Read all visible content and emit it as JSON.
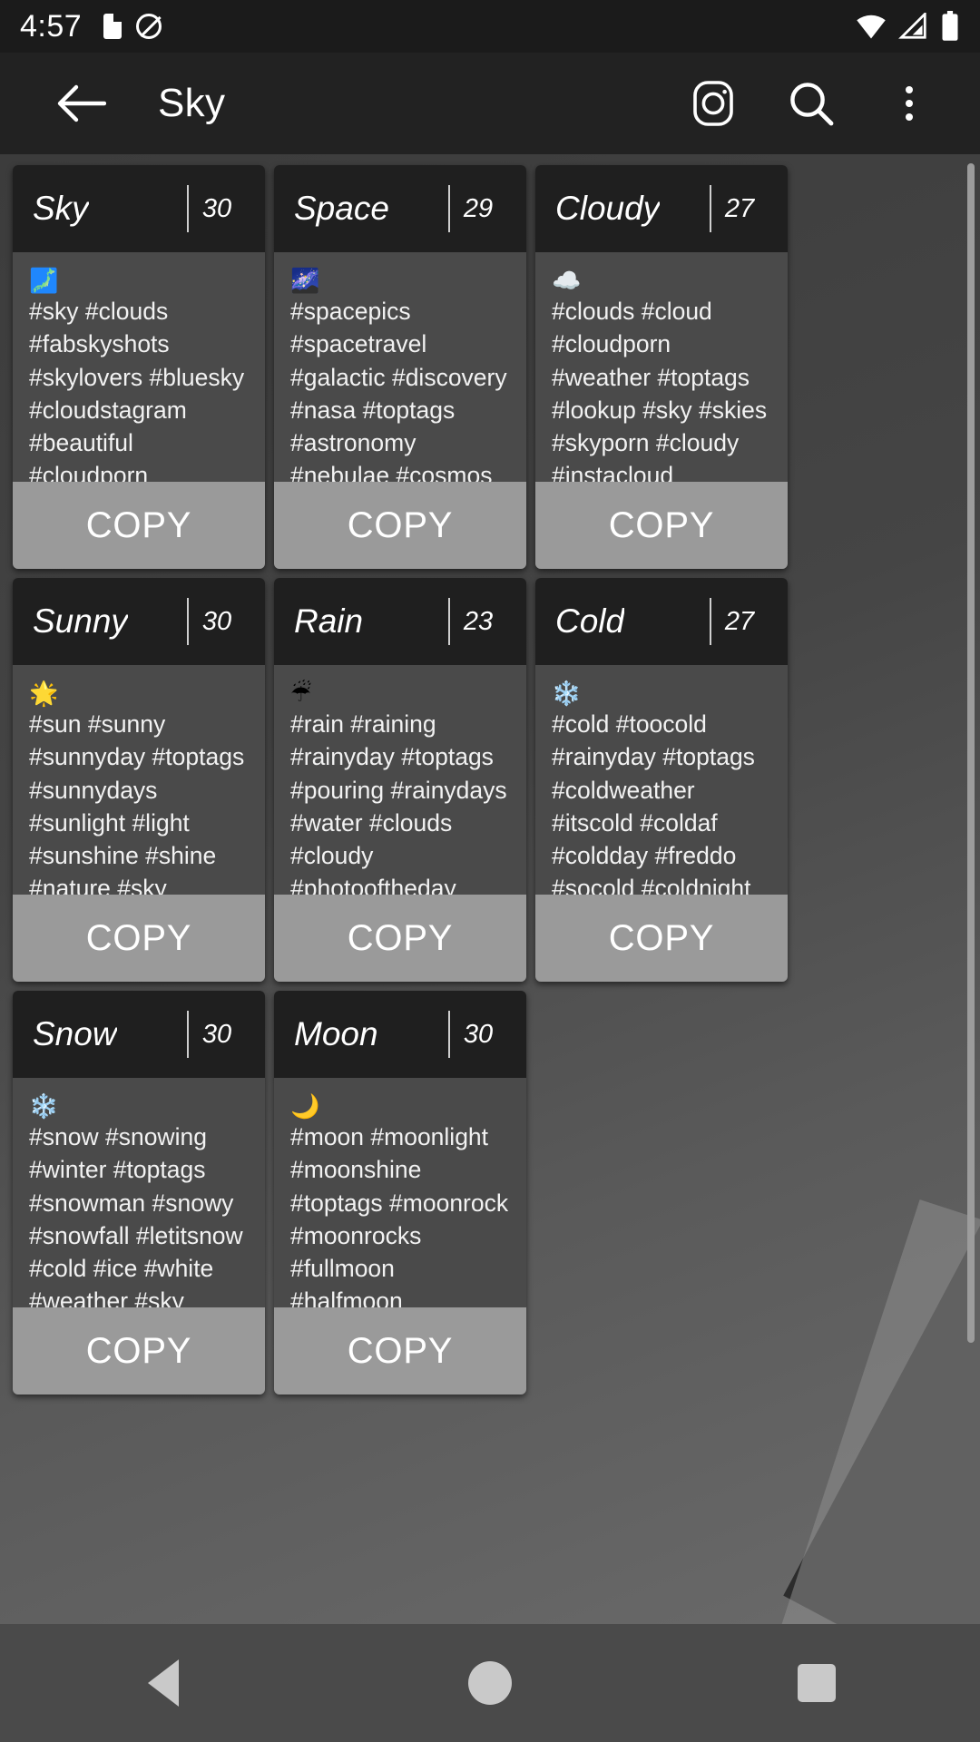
{
  "statusbar": {
    "clock": "4:57",
    "icons": [
      "sd-card-icon",
      "mute-icon",
      "wifi-icon",
      "signal-icon",
      "battery-icon"
    ]
  },
  "appbar": {
    "back_label": "back-arrow",
    "title": "Sky",
    "actions": [
      "instagram-icon",
      "search-icon",
      "overflow-menu-icon"
    ]
  },
  "cards": [
    {
      "title": "Sky",
      "count": "30",
      "emoji": "🗾",
      "tags": "#sky #clouds #fabskyshots #skylovers #bluesky #cloudstagram #beautiful #cloudporn #skyporn #air #toptags #blue #white #ic_skies #beauty #global_sky #skysnappers #skieshunter #igworldsky #thebestskyever #iskyhub …",
      "copy_label": "COPY"
    },
    {
      "title": "Space",
      "count": "29",
      "emoji": "🌌",
      "tags": "#spacepics #spacetravel #galactic #discovery #nasa #toptags #astronomy #nebulae #cosmos #universe #science #constellation #universe #spacetime #outerspace #space #nightsky #galaxy #nasabeyond #deepsky #…",
      "copy_label": "COPY"
    },
    {
      "title": "Cloudy",
      "count": "27",
      "emoji": "☁️",
      "tags": "#clouds #cloud #cloudporn #weather #toptags #lookup #sky #skies #skyporn #cloudy #instacloud #instaclouds #instagood #nature #beautiful #gloomy #skyline #horizon #overcast #instasky #epicsky #crazyclouds #p…",
      "copy_label": "COPY"
    },
    {
      "title": "Sunny",
      "count": "30",
      "emoji": "🌟",
      "tags": "#sun #sunny #sunnyday #toptags #sunnydays #sunlight #light #sunshine #shine #nature #sky #skywatcher #thesun #sunrays #photooftheday #beautiful #beautifulday #weather #summer #goodday #goodweather #instasunny #instasun #in…",
      "copy_label": "COPY"
    },
    {
      "title": "Rain",
      "count": "23",
      "emoji": "☔",
      "tags": "#rain #raining #rainyday #toptags #pouring #rainydays #water #clouds #cloudy #photooftheday #puddle #umbrella #instagood #gloomy #rainyweather #rainydayz #splash #downpour #instarain #sky #moment #amazing #instadaily",
      "copy_label": "COPY"
    },
    {
      "title": "Cold",
      "count": "27",
      "emoji": "❄️",
      "tags": "#cold #toocold #rainyday #toptags #coldweather #itscold #coldaf #coldday #freddo #socold #coldnight #coldmornings #imcold #verycold #instalike #instalikes #instacold #supercold #gettingcold #feelingcold #freezing #t…",
      "copy_label": "COPY"
    },
    {
      "title": "Snow",
      "count": "30",
      "emoji": "❄️",
      "tags": "#snow #snowing #winter #toptags #snowman #snowy #snowfall #letitsnow #cold #ice #white #weather #sky #skies #frosty #frost #chilly #nature #snowflakes #instagood #wintertime #winterwonderland #whiteworld #joy #instawi…",
      "copy_label": "COPY"
    },
    {
      "title": "Moon",
      "count": "30",
      "emoji": "🌙",
      "tags": "#moon #moonlight #moonshine #toptags #moonrock #moonrocks #fullmoon #halfmoon #newmoon #themoon #goodnightmoon #mooney #sky #skies #moonphases #moonlovers #moonrise #nature #instamoon #ig_moon #nightsky #luna…",
      "copy_label": "COPY"
    }
  ],
  "navbar": {
    "back": "nav-back",
    "home": "nav-home",
    "recents": "nav-recents"
  },
  "colors": {
    "appbar_bg": "#222222",
    "card_header_bg": "#1f1f1f",
    "card_body_bg": "#4a4a4a",
    "copy_bg": "#9a9a9a",
    "text": "#ffffff"
  }
}
